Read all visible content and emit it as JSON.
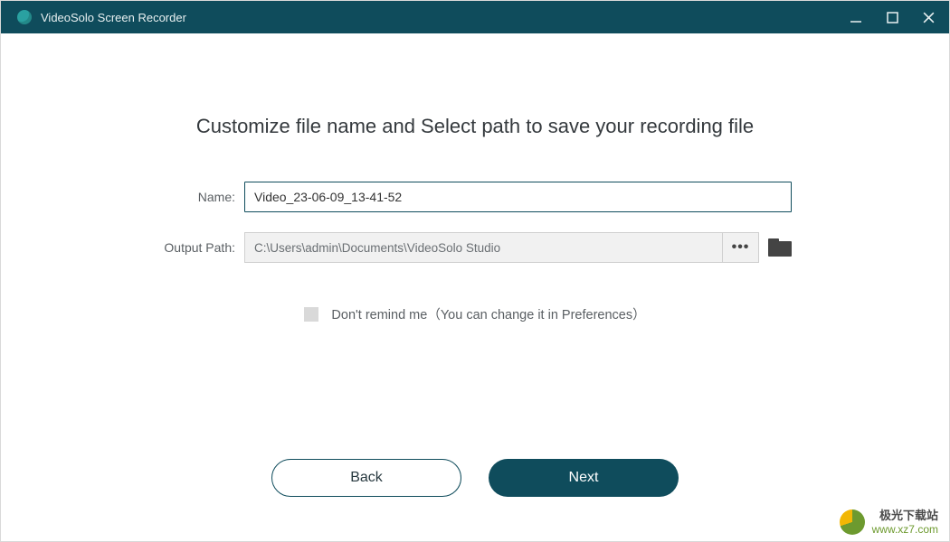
{
  "window": {
    "title": "VideoSolo Screen Recorder"
  },
  "heading": "Customize file name and Select path to save your recording file",
  "form": {
    "name_label": "Name:",
    "name_value": "Video_23-06-09_13-41-52",
    "path_label": "Output Path:",
    "path_value": "C:\\Users\\admin\\Documents\\VideoSolo Studio",
    "more_label": "•••"
  },
  "reminder": {
    "text": "Don't remind me（You can change it in Preferences）",
    "checked": false
  },
  "buttons": {
    "back": "Back",
    "next": "Next"
  },
  "watermark": {
    "cn": "极光下载站",
    "url": "www.xz7.com"
  }
}
